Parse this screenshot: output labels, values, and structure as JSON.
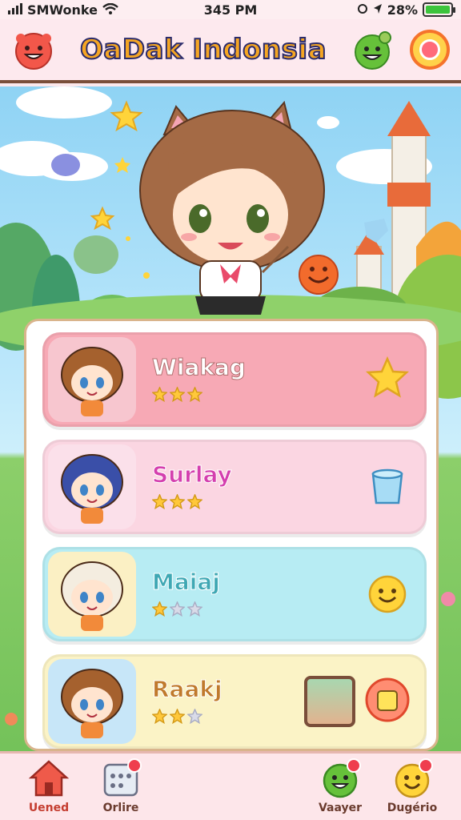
{
  "status_bar": {
    "carrier": "SMWonke",
    "time": "345 PM",
    "battery": "28%",
    "battery_level": 1.0
  },
  "header": {
    "title": "OaDak Indonsia"
  },
  "characters": [
    {
      "name": "Wiakag",
      "color": "#ffffff",
      "stroke": "#b07070",
      "rating": 3,
      "card_color": "#f7a9b5",
      "action_icon": "star-icon"
    },
    {
      "name": "Surlay",
      "color": "#d43fae",
      "rating": 3,
      "card_color": "#fbd6e2",
      "action_icon": "bucket-icon"
    },
    {
      "name": "Maiaj",
      "color": "#3fa8b4",
      "rating": 1,
      "card_color": "#b7ecf3",
      "action_icon": "smiley-icon"
    },
    {
      "name": "Raakj",
      "color": "#c07a2c",
      "rating": 2,
      "card_color": "#fbf3c6",
      "action_icon": "bag-icon"
    }
  ],
  "nav": {
    "items": [
      {
        "label": "Uened",
        "icon": "home-icon"
      },
      {
        "label": "Orlire",
        "icon": "calendar-icon"
      },
      {
        "label": "Vaayer",
        "icon": "character-icon"
      },
      {
        "label": "Dugério",
        "icon": "smiley-badge-icon"
      }
    ]
  },
  "colors": {
    "accent": "#f5a623",
    "title_outline": "#2b2b6b",
    "frame": "#7a4e3a"
  }
}
